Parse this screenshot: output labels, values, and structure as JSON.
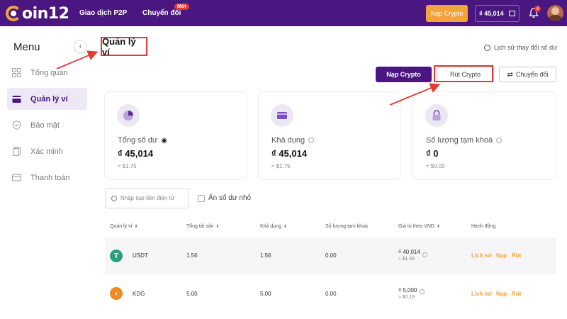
{
  "header": {
    "logo_text": "oin12",
    "nav": [
      {
        "label": "Giao dịch P2P"
      },
      {
        "label": "Chuyển đổi",
        "badge": "Mới"
      }
    ],
    "deposit_button": "Nạp Crypto",
    "balance": "₫ 45,014",
    "notification_count": "8"
  },
  "sidebar": {
    "title": "Menu",
    "items": [
      {
        "label": "Tổng quan",
        "icon": "grid-icon",
        "active": false
      },
      {
        "label": "Quản lý ví",
        "icon": "wallet-icon",
        "active": true
      },
      {
        "label": "Bảo mật",
        "icon": "shield-icon",
        "active": false
      },
      {
        "label": "Xác minh",
        "icon": "document-icon",
        "active": false
      },
      {
        "label": "Thanh toán",
        "icon": "card-icon",
        "active": false
      }
    ]
  },
  "main": {
    "title": "Quản lý ví",
    "history_link": "Lịch sử thay đổi số dư",
    "actions": {
      "deposit": "Nạp Crypto",
      "withdraw": "Rút Crypto",
      "transfer": "Chuyển đổi"
    },
    "cards": [
      {
        "label": "Tổng số dư",
        "amount": "₫ 45,014",
        "sub": "≈ $1.75"
      },
      {
        "label": "Khả dụng",
        "amount": "₫ 45,014",
        "sub": "≈ $1.75"
      },
      {
        "label": "Số lượng tạm khoá",
        "amount": "₫ 0",
        "sub": "≈ $0.00"
      }
    ],
    "search_placeholder": "Nhập loại tiền điện tử",
    "hide_small_label": "Ẩn số dư nhỏ",
    "table": {
      "headers": [
        "Quản lý ví",
        "Tổng tài sản",
        "Khả dụng",
        "Số lượng tạm khoá",
        "Giá trị theo VND",
        "Hành động"
      ],
      "rows": [
        {
          "coin": "USDT",
          "total": "1.56",
          "available": "1.56",
          "locked": "0.00",
          "vnd": "₫ 40,014",
          "usd": "≈ $1.56",
          "actions": [
            "Lịch sử",
            "Nạp",
            "Rút"
          ]
        },
        {
          "coin": "KDG",
          "total": "5.00",
          "available": "5.00",
          "locked": "0.00",
          "vnd": "₫ 5,000",
          "usd": "≈ $0.19",
          "actions": [
            "Lịch sử",
            "Nạp",
            "Rút"
          ]
        }
      ]
    }
  },
  "colors": {
    "brand_purple": "#4a1780",
    "accent_orange": "#f6a23a",
    "highlight_red": "#e53935",
    "usdt_green": "#26a17b",
    "kdg_orange": "#f08a24"
  }
}
